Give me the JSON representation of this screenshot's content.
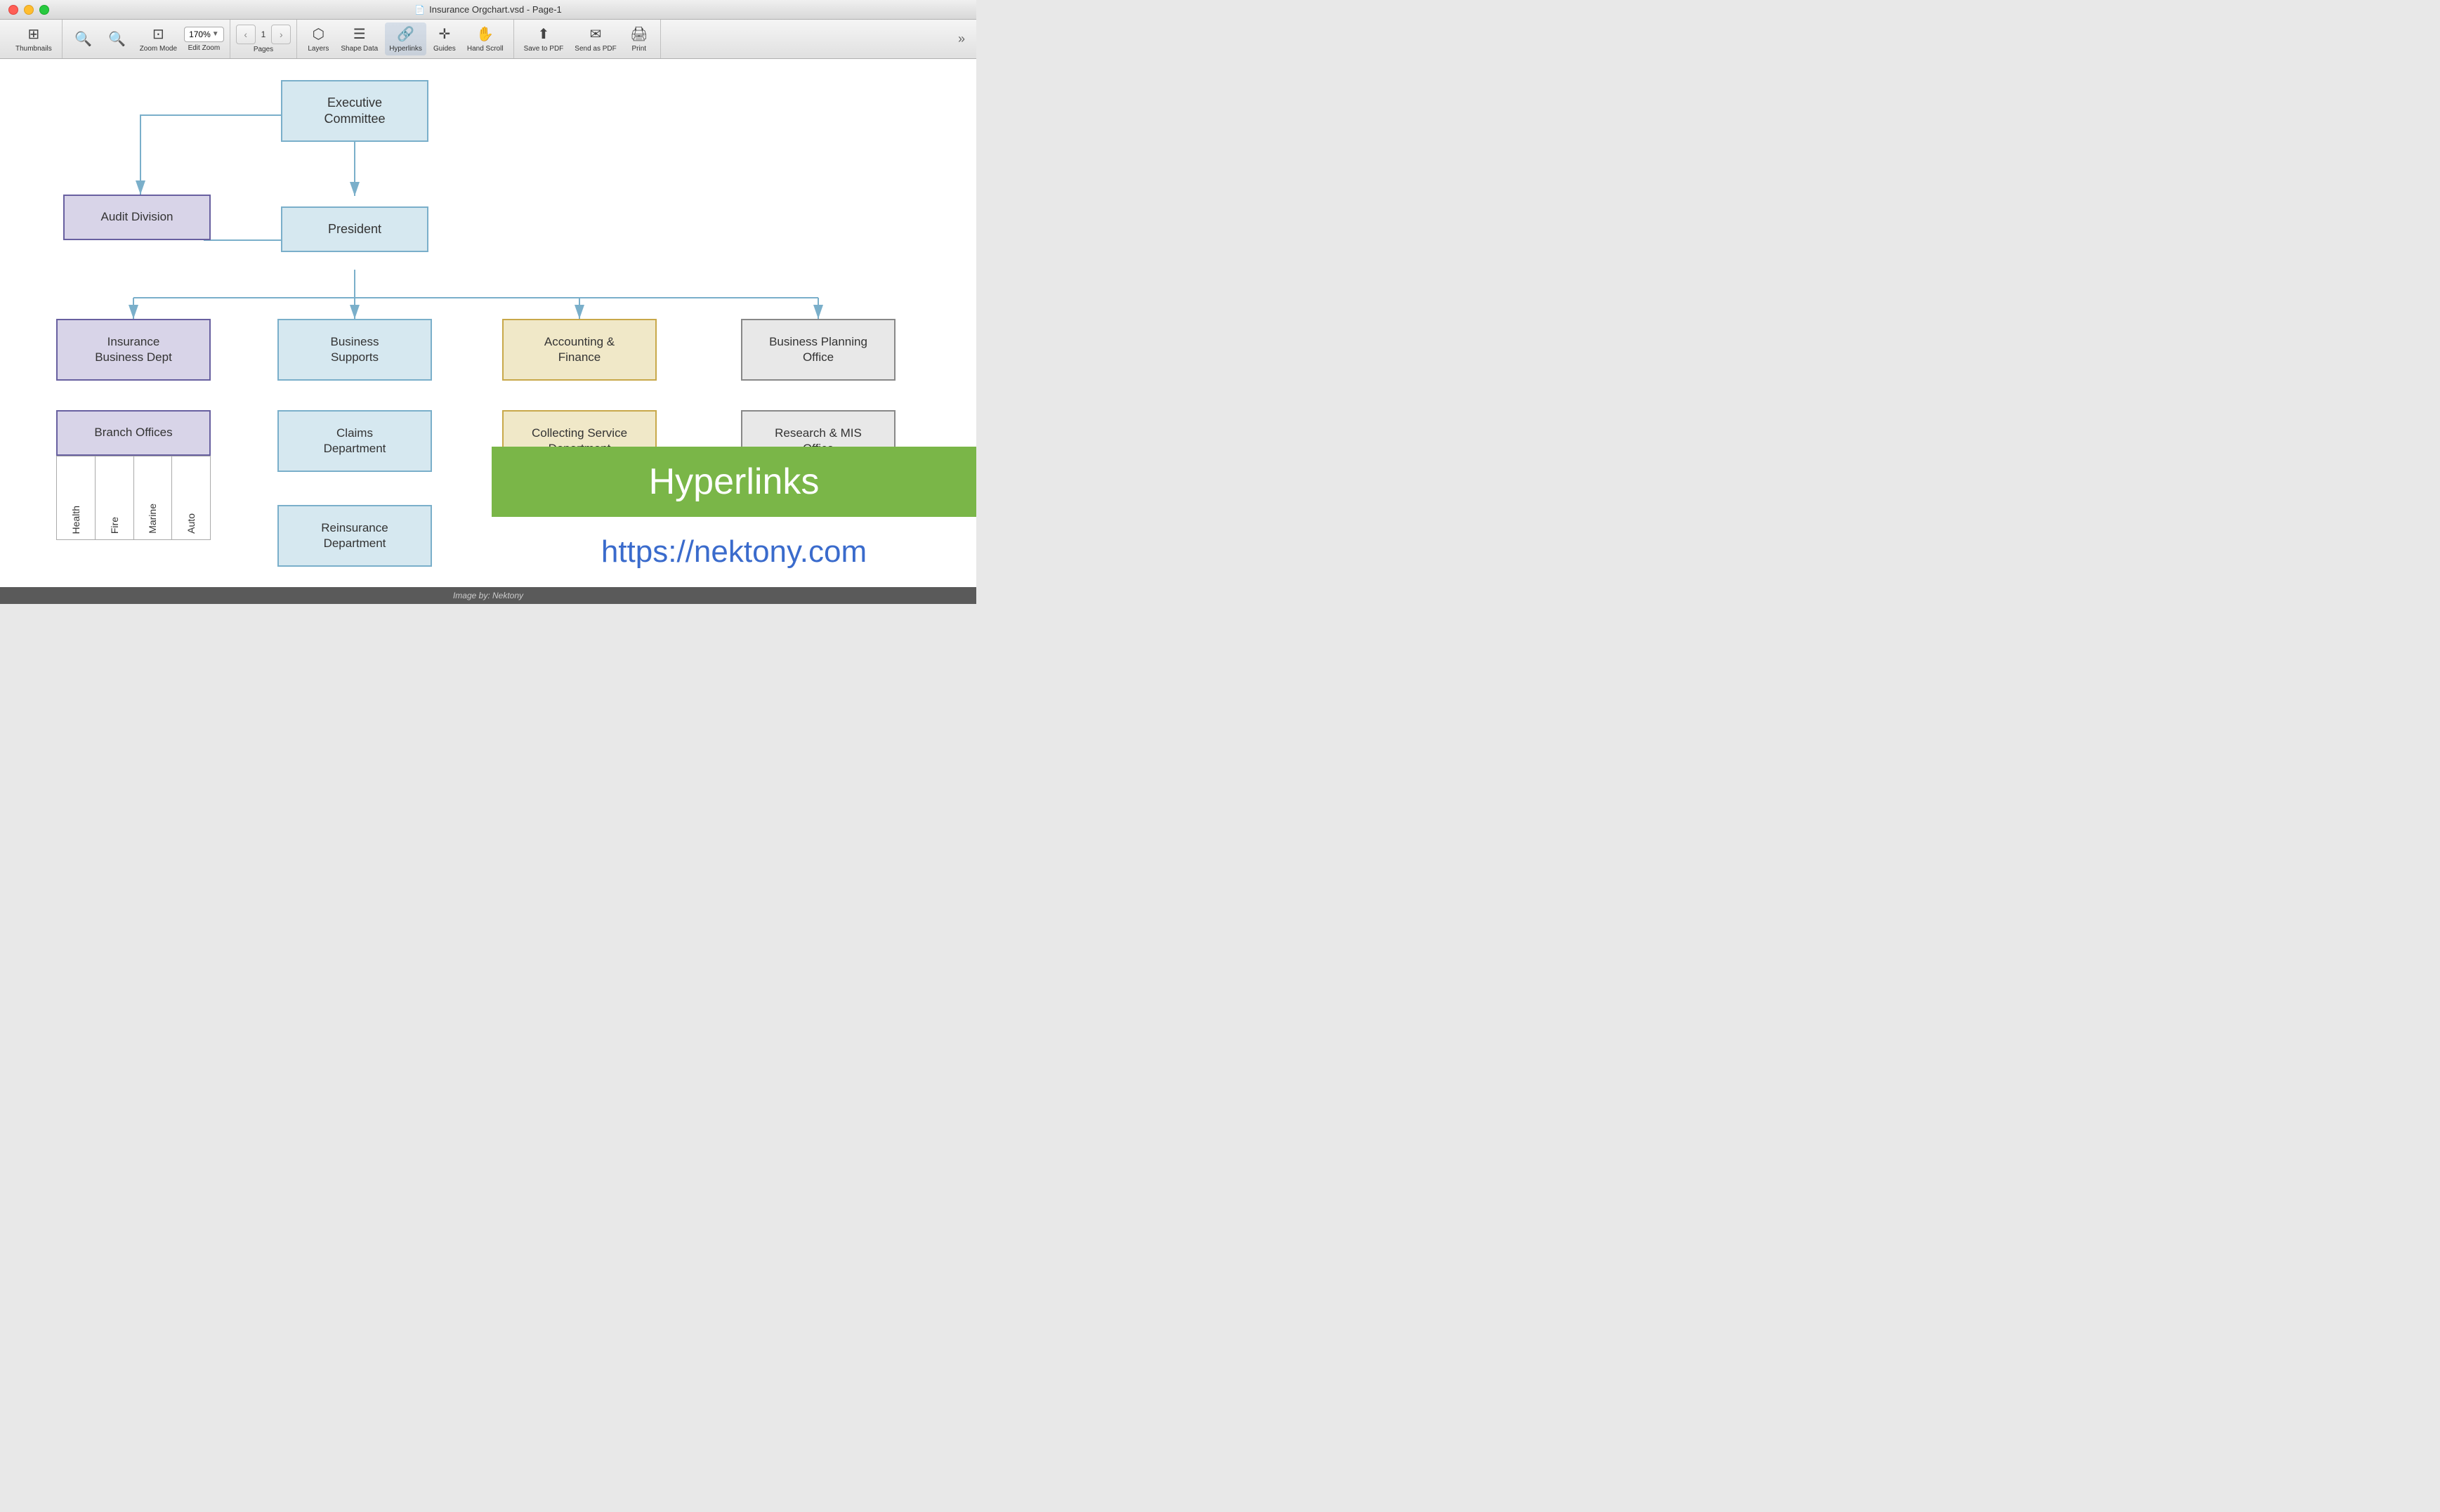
{
  "window": {
    "title": "Insurance Orgchart.vsd - Page-1",
    "traffic_lights": [
      "close",
      "minimize",
      "maximize"
    ]
  },
  "toolbar": {
    "thumbnails_label": "Thumbnails",
    "zoom_label": "Zoom",
    "zoom_mode_label": "Zoom Mode",
    "edit_zoom_label": "Edit Zoom",
    "zoom_value": "170%",
    "pages_label": "Pages",
    "page_num": "1",
    "layers_label": "Layers",
    "shape_data_label": "Shape Data",
    "hyperlinks_label": "Hyperlinks",
    "guides_label": "Guides",
    "hand_scroll_label": "Hand Scroll",
    "save_to_pdf_label": "Save to PDF",
    "send_as_pdf_label": "Send as PDF",
    "print_label": "Print"
  },
  "orgchart": {
    "nodes": {
      "executive_committee": "Executive\nCommittee",
      "audit_division": "Audit Division",
      "president": "President",
      "insurance_business_dept": "Insurance\nBusiness Dept",
      "business_supports": "Business\nSupports",
      "accounting_finance": "Accounting &\nFinance",
      "business_planning_office": "Business Planning\nOffice",
      "branch_offices": "Branch Offices",
      "claims_department": "Claims\nDepartment",
      "collecting_service_department": "Collecting Service\nDepartment",
      "research_mis_office": "Research & MIS\nOffice",
      "reinsurance_department": "Reinsurance\nDepartment"
    },
    "branch_items": [
      "Health",
      "Fire",
      "Marine",
      "Auto"
    ]
  },
  "hyperlinks": {
    "title": "Hyperlinks",
    "url": "https://nektony.com"
  },
  "status_bar": {
    "text": "Image by: Nektony"
  }
}
